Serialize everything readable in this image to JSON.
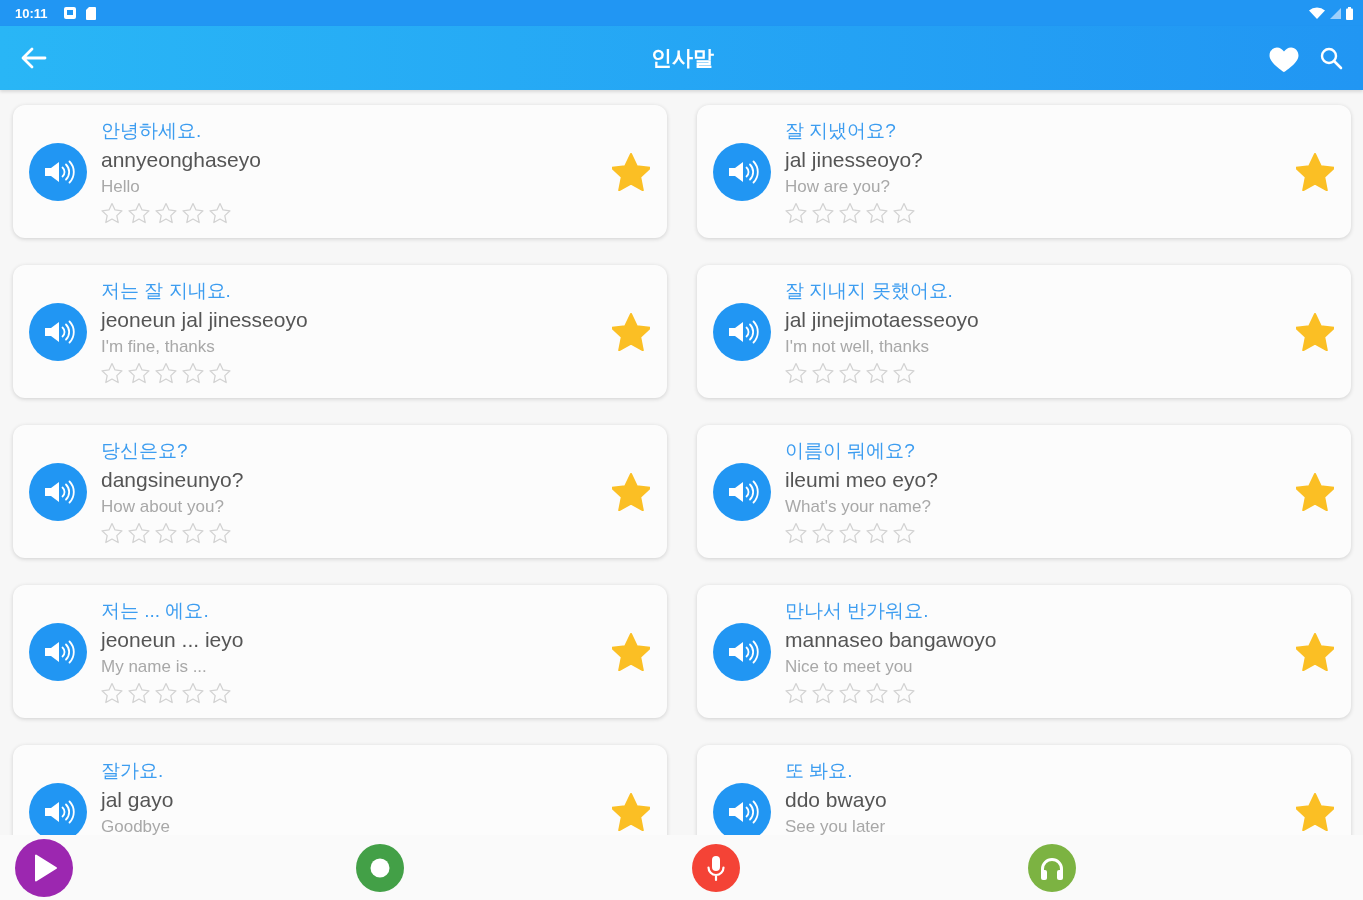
{
  "status_bar": {
    "time": "10:11"
  },
  "app_bar": {
    "title": "인사말"
  },
  "phrases": [
    {
      "korean": "안녕하세요.",
      "romanization": "annyeonghaseyo",
      "english": "Hello",
      "stars": 0,
      "favorite": true
    },
    {
      "korean": "잘 지냈어요?",
      "romanization": "jal jinesseoyo?",
      "english": "How are you?",
      "stars": 0,
      "favorite": true
    },
    {
      "korean": "저는 잘 지내요.",
      "romanization": "jeoneun jal jinesseoyo",
      "english": "I'm fine, thanks",
      "stars": 0,
      "favorite": true
    },
    {
      "korean": "잘 지내지 못했어요.",
      "romanization": "jal jinejimotaesseoyo",
      "english": "I'm not well, thanks",
      "stars": 0,
      "favorite": true
    },
    {
      "korean": "당신은요?",
      "romanization": "dangsineunyo?",
      "english": "How about you?",
      "stars": 0,
      "favorite": true
    },
    {
      "korean": "이름이 뭐에요?",
      "romanization": "ileumi meo eyo?",
      "english": "What's your name?",
      "stars": 0,
      "favorite": true
    },
    {
      "korean": "저는 ... 에요.",
      "romanization": "jeoneun ... ieyo",
      "english": "My name is ...",
      "stars": 0,
      "favorite": true
    },
    {
      "korean": "만나서 반가워요.",
      "romanization": "mannaseo bangawoyo",
      "english": "Nice to meet you",
      "stars": 0,
      "favorite": true
    },
    {
      "korean": "잘가요.",
      "romanization": "jal gayo",
      "english": "Goodbye",
      "favorite": true
    },
    {
      "korean": "또 봐요.",
      "romanization": "ddo bwayo",
      "english": "See you later",
      "favorite": true
    }
  ],
  "bottom_bar": [
    {
      "kind": "play",
      "color": "#9c27b0"
    },
    {
      "kind": "record",
      "color": "#43a047"
    },
    {
      "kind": "microphone",
      "color": "#f44336"
    },
    {
      "kind": "headphones",
      "color": "#7cb342"
    }
  ]
}
